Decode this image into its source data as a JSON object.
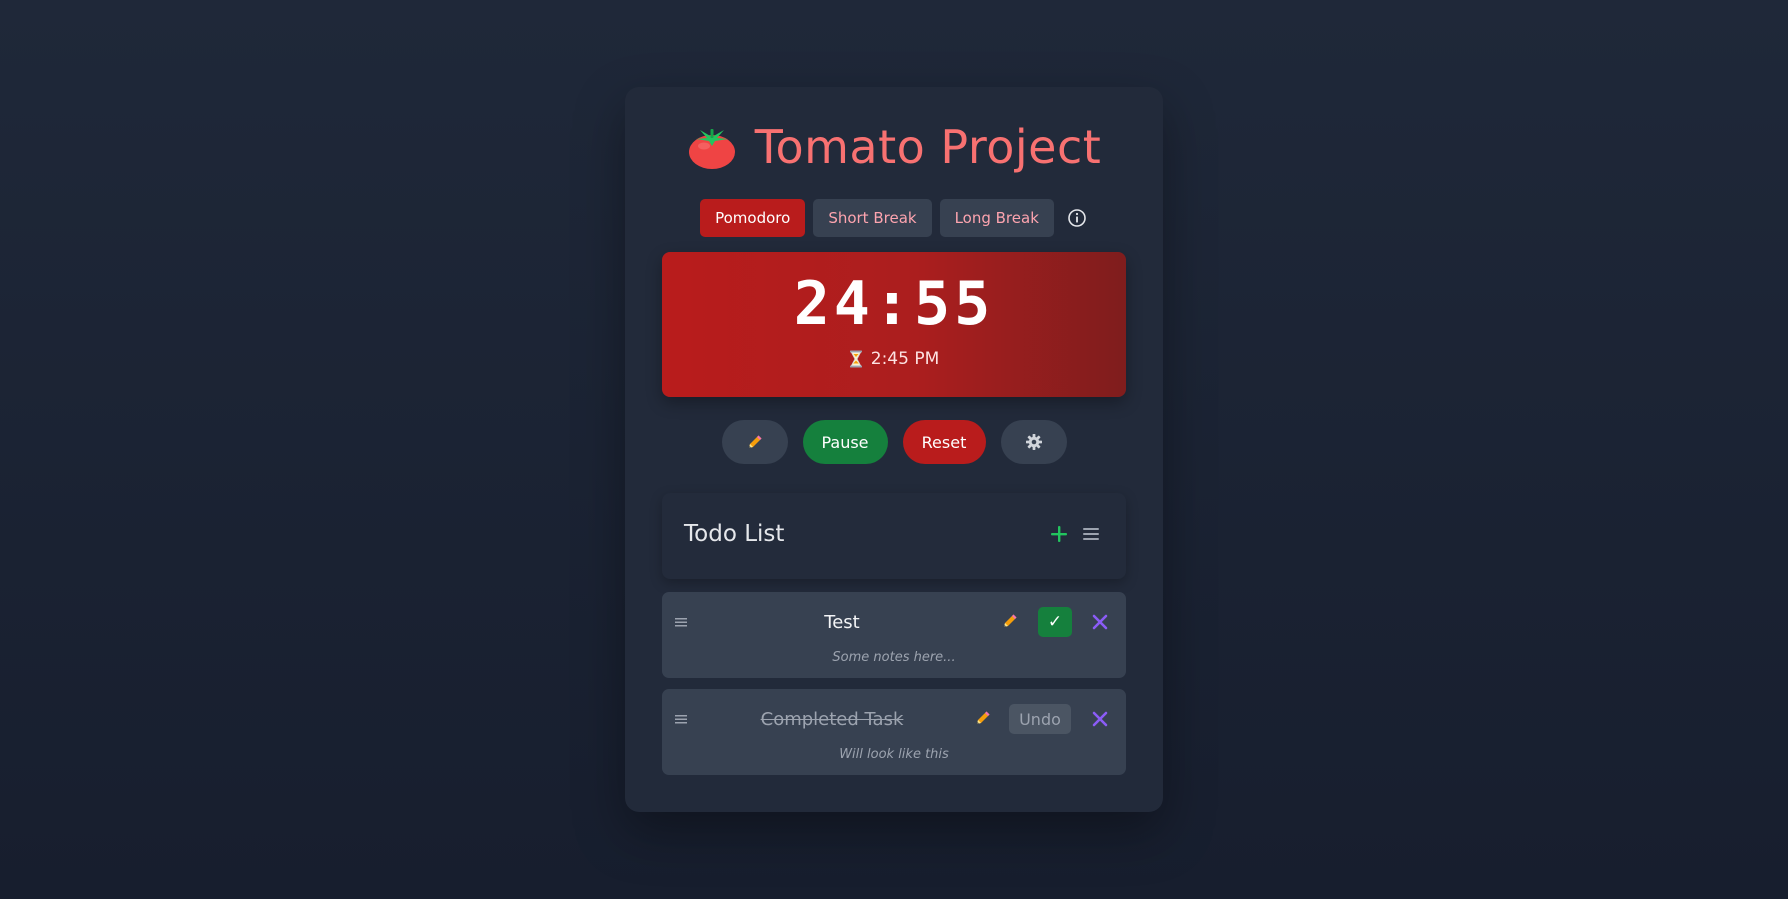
{
  "header": {
    "title": "Tomato Project",
    "logo_icon": "tomato-icon"
  },
  "modes": {
    "items": [
      "Pomodoro",
      "Short Break",
      "Long Break"
    ],
    "active": "Pomodoro",
    "info_icon": "info-icon"
  },
  "timer": {
    "display": "24:55",
    "end_time": "2:45 PM",
    "end_icon": "hourglass-icon"
  },
  "controls": {
    "edit_icon": "pencil-icon",
    "pause_label": "Pause",
    "reset_label": "Reset",
    "settings_icon": "gear-icon"
  },
  "todo": {
    "title": "Todo List",
    "add_icon": "plus-icon",
    "menu_icon": "menu-icon",
    "items": [
      {
        "name": "Test",
        "notes": "Some notes here...",
        "completed": false,
        "action_label": "✓"
      },
      {
        "name": "Completed Task",
        "notes": "Will look like this",
        "completed": true,
        "action_label": "Undo"
      }
    ]
  },
  "colors": {
    "accent_red": "#b91c1c",
    "title_red": "#f87171",
    "green": "#15803d",
    "card_bg": "#222a3a",
    "page_bg": "#1c2434",
    "delete_purple": "#8b5cf6"
  }
}
